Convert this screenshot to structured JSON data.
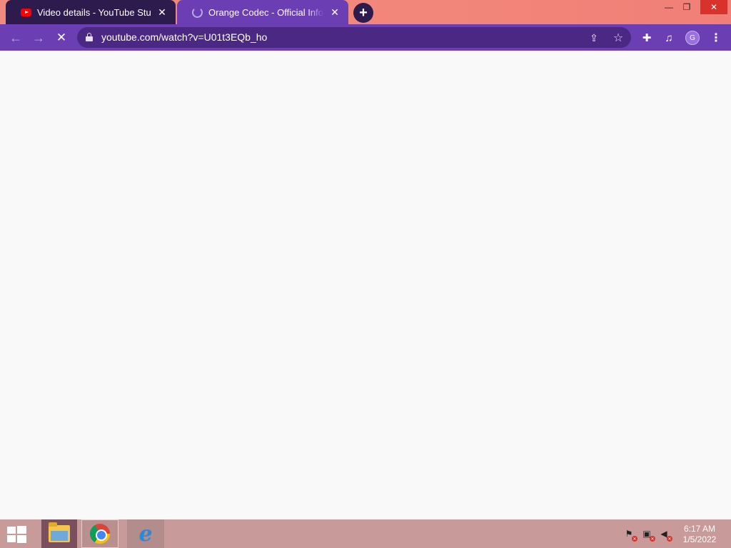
{
  "tabs": [
    {
      "title": "Video details - YouTube Studio",
      "favicon": "youtube-icon",
      "active": false
    },
    {
      "title": "Orange Codec - Official Infomercial",
      "favicon": "loading-spinner-icon",
      "active": true
    }
  ],
  "toolbar": {
    "url": "youtube.com/watch?v=U01t3EQb_ho",
    "profile_initial": "G"
  },
  "taskbar": {
    "apps": [
      "file-explorer-icon",
      "chrome-icon",
      "internet-explorer-icon"
    ],
    "clock": {
      "time": "6:17 AM",
      "date": "1/5/2022"
    }
  },
  "colors": {
    "tabstrip": "#f2867a",
    "toolbar": "#6b3fb3",
    "inactive_tab": "#2d1b4e",
    "taskbar": "#c99a9a"
  }
}
